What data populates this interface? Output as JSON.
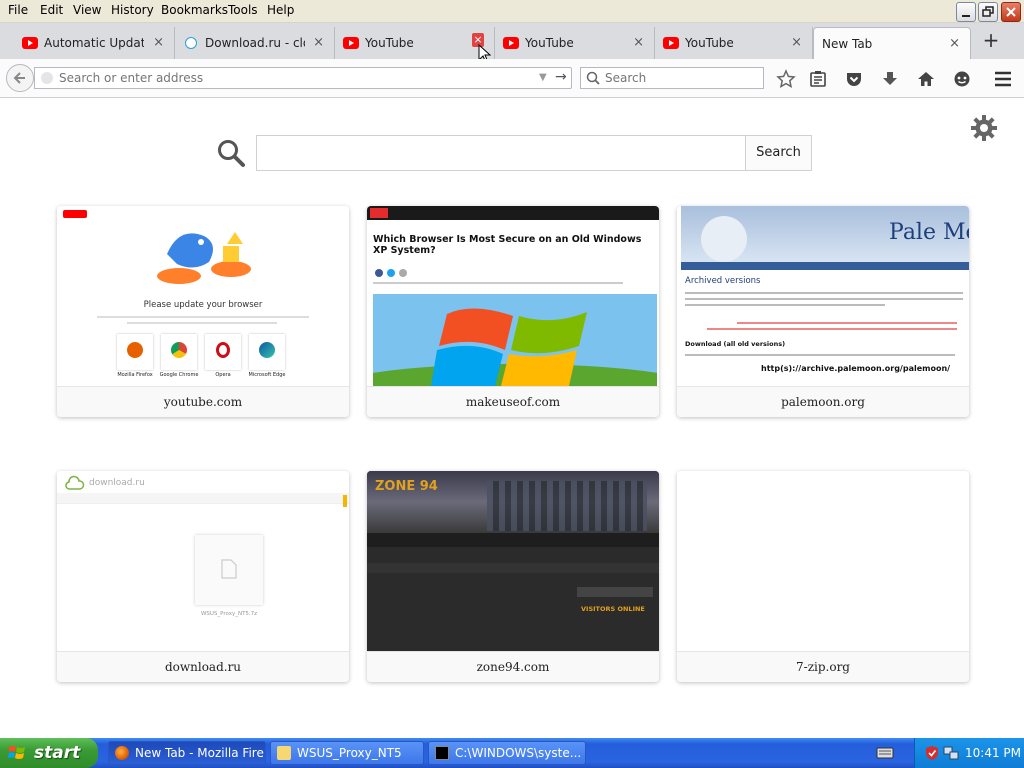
{
  "menubar": {
    "items": [
      "File",
      "Edit",
      "View",
      "History",
      "Bookmarks",
      "Tools",
      "Help"
    ],
    "accel": [
      "F",
      "E",
      "V",
      "H",
      "B",
      "T",
      "H"
    ]
  },
  "tabs": [
    {
      "title": "Automatic Updates...",
      "icon": "youtube-icon",
      "close": "×"
    },
    {
      "title": "Download.ru - clou...",
      "icon": "download-ru-icon",
      "close": "×"
    },
    {
      "title": "YouTube",
      "icon": "youtube-icon",
      "close": "×"
    },
    {
      "title": "YouTube",
      "icon": "youtube-icon",
      "close": "×"
    },
    {
      "title": "YouTube",
      "icon": "youtube-icon",
      "close": "×"
    },
    {
      "title": "New Tab",
      "icon": "none",
      "close": "×"
    }
  ],
  "newtab": "+",
  "navbar": {
    "url_placeholder": "Search or enter address",
    "search_placeholder": "Search"
  },
  "content": {
    "search_button": "Search",
    "tiles": [
      {
        "label": "youtube.com"
      },
      {
        "label": "makeuseof.com"
      },
      {
        "label": "palemoon.org"
      },
      {
        "label": "download.ru"
      },
      {
        "label": "zone94.com"
      },
      {
        "label": "7-zip.org"
      }
    ],
    "thumbs": {
      "youtube": {
        "update_text": "Please update your browser",
        "browsers": [
          "Mozilla Firefox",
          "Google Chrome",
          "Opera",
          "Microsoft Edge"
        ]
      },
      "makeuseof": {
        "headline": "Which Browser Is Most Secure on an Old Windows XP System?"
      },
      "palemoon": {
        "brand": "Pale Mo",
        "heading": "Archived versions",
        "download": "Download (all old versions)",
        "link": "http(s)://archive.palemoon.org/palemoon/"
      },
      "downloadru": {
        "brand": "download.ru",
        "file": "WSUS_Proxy_NT5.7z"
      },
      "zone94": {
        "brand": "ZONE 94",
        "visitors": "VISITORS ONLINE"
      }
    }
  },
  "taskbar": {
    "start": "start",
    "tasks": [
      {
        "label": "New Tab - Mozilla Fire...",
        "active": true
      },
      {
        "label": "WSUS_Proxy_NT5",
        "active": false
      },
      {
        "label": "C:\\WINDOWS\\syste...",
        "active": false
      }
    ],
    "clock": "10:41 PM"
  },
  "colors": {
    "youtube_red": "#ff0000",
    "xp_blue": "#245edb",
    "start_green": "#3a9b35"
  }
}
